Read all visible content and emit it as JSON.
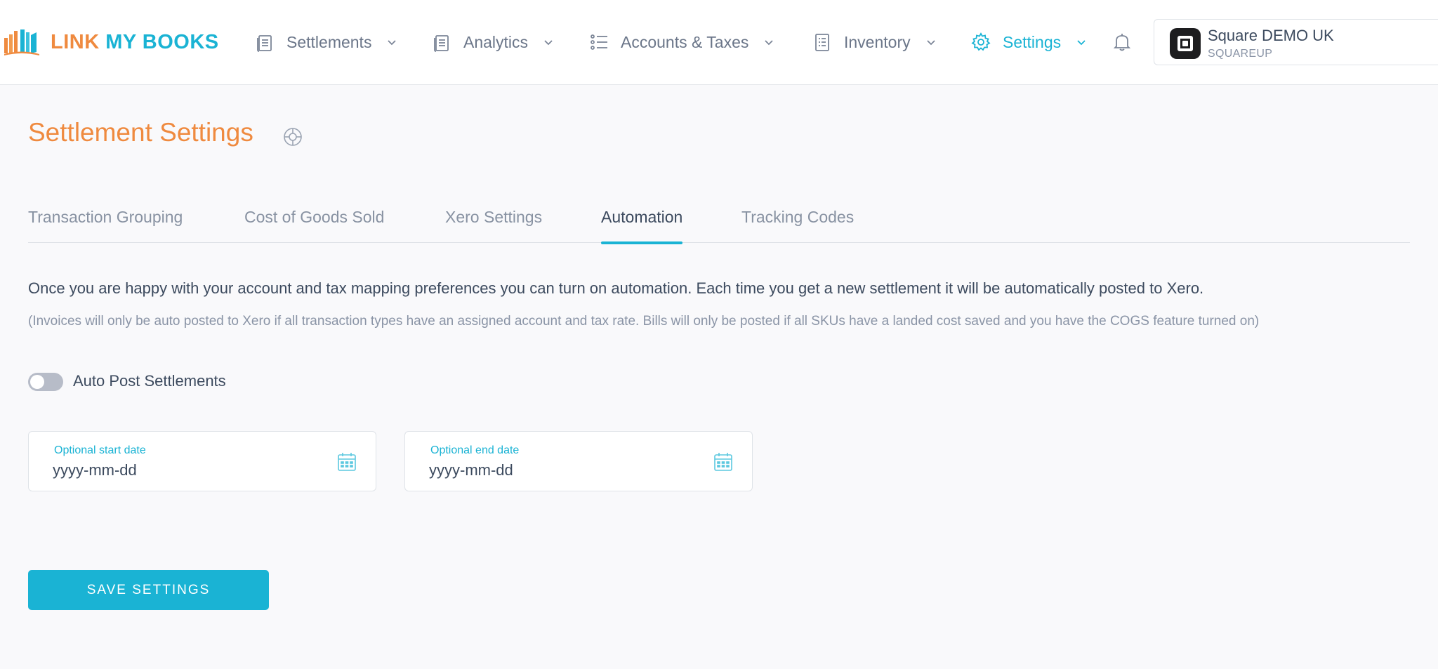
{
  "brand": {
    "word1": "LINK",
    "word2": "MY BOOKS",
    "colors": {
      "orange": "#ef8a3f",
      "cyan": "#1ab3d4"
    }
  },
  "nav": {
    "items": [
      {
        "label": "Settlements",
        "icon": "document-icon",
        "active": false
      },
      {
        "label": "Analytics",
        "icon": "document-icon",
        "active": false
      },
      {
        "label": "Accounts & Taxes",
        "icon": "list-icon",
        "active": false
      },
      {
        "label": "Inventory",
        "icon": "clipboard-icon",
        "active": false
      },
      {
        "label": "Settings",
        "icon": "gear-icon",
        "active": true
      }
    ],
    "notifications_icon": "bell-icon"
  },
  "account": {
    "name": "Square DEMO UK",
    "platform": "SQUAREUP"
  },
  "page": {
    "title": "Settlement Settings",
    "help_icon": "lifebuoy-icon"
  },
  "tabs": [
    {
      "label": "Transaction Grouping",
      "active": false
    },
    {
      "label": "Cost of Goods Sold",
      "active": false
    },
    {
      "label": "Xero Settings",
      "active": false
    },
    {
      "label": "Automation",
      "active": true
    },
    {
      "label": "Tracking Codes",
      "active": false
    }
  ],
  "automation": {
    "description": "Once you are happy with your account and tax mapping preferences you can turn on automation. Each time you get a new settlement it will be automatically posted to Xero.",
    "note": "(Invoices will only be auto posted to Xero if all transaction types have an assigned account and tax rate. Bills will only be posted if all SKUs have a landed cost saved and you have the COGS feature turned on)",
    "toggle_label": "Auto Post Settlements",
    "toggle_on": false,
    "start_date": {
      "label": "Optional start date",
      "placeholder": "yyyy-mm-dd",
      "value": ""
    },
    "end_date": {
      "label": "Optional end date",
      "placeholder": "yyyy-mm-dd",
      "value": ""
    },
    "save_label": "SAVE SETTINGS"
  }
}
